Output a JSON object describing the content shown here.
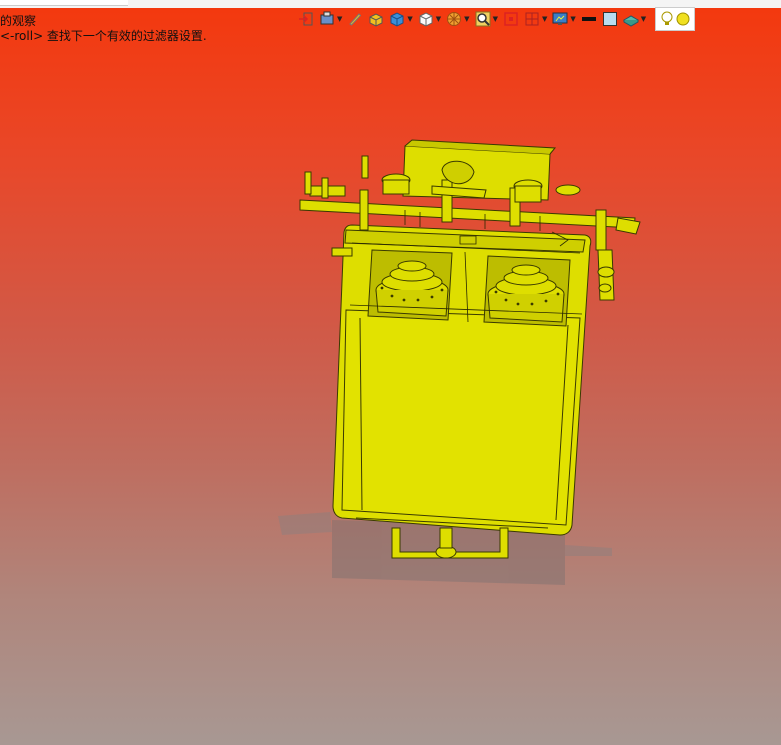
{
  "hints": {
    "line1": "的观察",
    "line2": "<-roll> 查找下一个有效的过滤器设置."
  },
  "toolbar": [
    {
      "name": "exit-view-icon",
      "dropdown": false
    },
    {
      "name": "view-orient-icon",
      "dropdown": true
    },
    {
      "name": "pen-icon",
      "dropdown": false
    },
    {
      "name": "shaded-box-icon",
      "dropdown": false
    },
    {
      "name": "blue-cube-icon",
      "dropdown": true
    },
    {
      "name": "white-cube-icon",
      "dropdown": true
    },
    {
      "name": "section-wheel-icon",
      "dropdown": true
    },
    {
      "name": "zoom-magnifier-icon",
      "dropdown": true
    },
    {
      "name": "red-target-icon",
      "dropdown": false
    },
    {
      "name": "clip-plane-icon",
      "dropdown": true
    },
    {
      "name": "monitor-display-icon",
      "dropdown": true
    },
    {
      "name": "black-bar-icon",
      "dropdown": false
    },
    {
      "name": "blue-square-icon",
      "dropdown": false
    },
    {
      "name": "layer-plate-icon",
      "dropdown": true
    },
    {
      "name": "light-bulb-icon",
      "dropdown": false
    }
  ],
  "colors": {
    "model_fill": "#dede00",
    "model_edge": "#3a3a00",
    "bg_top": "#f4380d",
    "bg_bottom": "#a89893"
  }
}
